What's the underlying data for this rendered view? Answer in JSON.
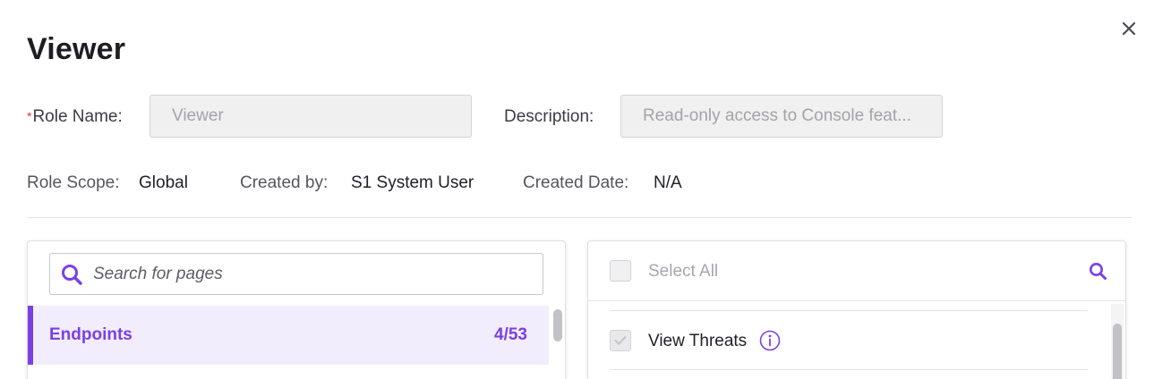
{
  "modal": {
    "title": "Viewer",
    "close_icon": "close-icon"
  },
  "form": {
    "role_name_required_mark": "*",
    "role_name_label": "Role Name:",
    "role_name_value": "Viewer",
    "description_label": "Description:",
    "description_value": "Read-only access to Console feat..."
  },
  "meta": {
    "role_scope_label": "Role Scope:",
    "role_scope_value": "Global",
    "created_by_label": "Created by:",
    "created_by_value": "S1 System User",
    "created_date_label": "Created Date:",
    "created_date_value": "N/A"
  },
  "left_panel": {
    "search_placeholder": "Search for pages",
    "search_icon": "search-icon",
    "items": [
      {
        "label": "Endpoints",
        "count": "4/53",
        "active": true
      }
    ]
  },
  "right_panel": {
    "select_all_label": "Select All",
    "search_icon": "search-icon",
    "permissions": [
      {
        "label": "View Threats",
        "checked": true,
        "info_icon": "info-icon"
      }
    ]
  },
  "colors": {
    "accent": "#7b3fe4",
    "active_bg": "#f1edfd",
    "required": "#d33a3a"
  }
}
